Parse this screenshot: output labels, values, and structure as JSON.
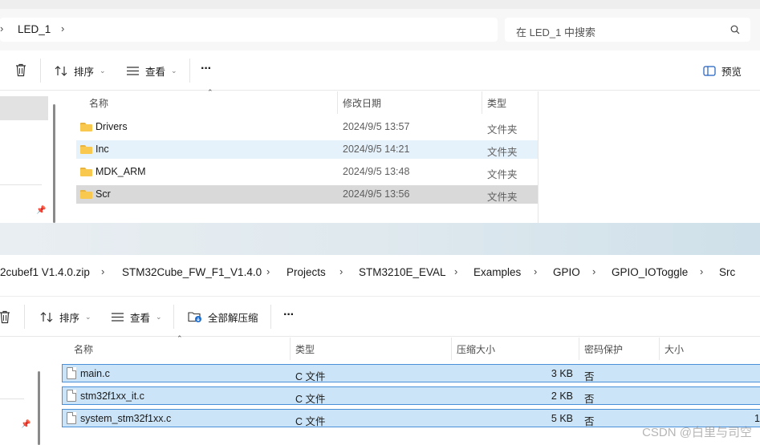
{
  "top_window": {
    "address": {
      "crumbs": [
        "LED_1"
      ]
    },
    "search": {
      "placeholder": "在 LED_1 中搜索"
    },
    "toolbar": {
      "sort_label": "排序",
      "view_label": "查看",
      "more_label": "···",
      "preview_label": "预览"
    },
    "columns": {
      "name": "名称",
      "modified": "修改日期",
      "type": "类型"
    },
    "rows": [
      {
        "name": "Drivers",
        "modified": "2024/9/5 13:57",
        "type": "文件夹"
      },
      {
        "name": "Inc",
        "modified": "2024/9/5 14:21",
        "type": "文件夹"
      },
      {
        "name": "MDK_ARM",
        "modified": "2024/9/5 13:48",
        "type": "文件夹"
      },
      {
        "name": "Scr",
        "modified": "2024/9/5 13:56",
        "type": "文件夹"
      }
    ]
  },
  "bottom_window": {
    "address": {
      "crumbs": [
        "2cubef1 V1.4.0.zip",
        "STM32Cube_FW_F1_V1.4.0",
        "Projects",
        "STM3210E_EVAL",
        "Examples",
        "GPIO",
        "GPIO_IOToggle",
        "Src"
      ]
    },
    "toolbar": {
      "sort_label": "排序",
      "view_label": "查看",
      "extract_label": "全部解压缩",
      "more_label": "···"
    },
    "columns": {
      "name": "名称",
      "type": "类型",
      "compressed": "压缩大小",
      "protected": "密码保护",
      "size": "大小"
    },
    "rows": [
      {
        "name": "main.c",
        "type": "C 文件",
        "compressed": "3 KB",
        "protected": "否",
        "size": ""
      },
      {
        "name": "stm32f1xx_it.c",
        "type": "C 文件",
        "compressed": "2 KB",
        "protected": "否",
        "size": ""
      },
      {
        "name": "system_stm32f1xx.c",
        "type": "C 文件",
        "compressed": "5 KB",
        "protected": "否",
        "size": "1"
      }
    ]
  },
  "watermark": "CSDN @白里与司空",
  "colors": {
    "hover_row": "#e5f1fb",
    "selected_row": "#d9d9d9",
    "selected_border": "#4a90d9",
    "selected_fill": "#cce4f7",
    "folder": "#f8c94e"
  }
}
